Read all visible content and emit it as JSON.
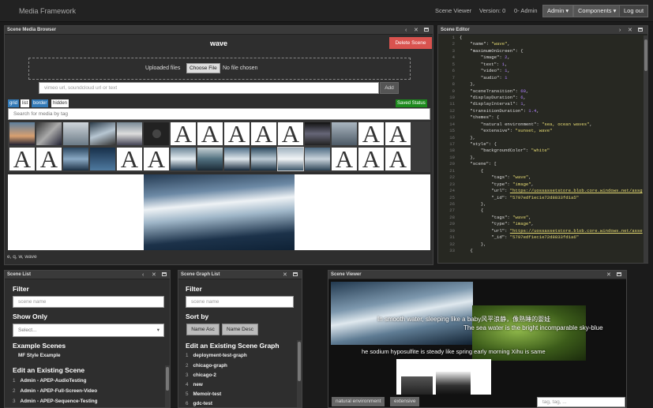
{
  "nav": {
    "title": "Media Framework",
    "scene_viewer": "Scene Viewer",
    "version": "Version: 0",
    "user": "0- Admin",
    "admin": "Admin ▾",
    "components": "Components ▾",
    "logout": "Log out"
  },
  "media_browser": {
    "title": "Scene Media Browser",
    "scene_name": "wave",
    "delete": "Delete Scene",
    "uploaded_label": "Uploaded files",
    "choose_file": "Choose File",
    "no_file": "No file chosen",
    "url_placeholder": "vimeo url, soundcloud url or text",
    "add": "Add",
    "views": [
      "grid",
      "list",
      "border",
      "hidden"
    ],
    "saved": "Saved Status",
    "tag_placeholder": "Search for media by tag",
    "tags_text": "e, q, w, wave"
  },
  "scene_editor": {
    "title": "Scene Editor",
    "lines": [
      [
        {
          "c": "k",
          "t": "{"
        }
      ],
      [
        {
          "c": "k",
          "t": "    \"name\": "
        },
        {
          "c": "s",
          "t": "\"wave\""
        },
        {
          "c": "k",
          "t": ","
        }
      ],
      [
        {
          "c": "k",
          "t": "    \"maximumOnScreen\": {"
        }
      ],
      [
        {
          "c": "k",
          "t": "        \"image\": "
        },
        {
          "c": "n",
          "t": "2"
        },
        {
          "c": "k",
          "t": ","
        }
      ],
      [
        {
          "c": "k",
          "t": "        \"text\": "
        },
        {
          "c": "n",
          "t": "1"
        },
        {
          "c": "k",
          "t": ","
        }
      ],
      [
        {
          "c": "k",
          "t": "        \"video\": "
        },
        {
          "c": "n",
          "t": "1"
        },
        {
          "c": "k",
          "t": ","
        }
      ],
      [
        {
          "c": "k",
          "t": "        \"audio\": "
        },
        {
          "c": "n",
          "t": "1"
        }
      ],
      [
        {
          "c": "k",
          "t": "    },"
        }
      ],
      [
        {
          "c": "k",
          "t": "    \"sceneTransition\": "
        },
        {
          "c": "n",
          "t": "60"
        },
        {
          "c": "k",
          "t": ","
        }
      ],
      [
        {
          "c": "k",
          "t": "    \"displayDuration\": "
        },
        {
          "c": "n",
          "t": "6"
        },
        {
          "c": "k",
          "t": ","
        }
      ],
      [
        {
          "c": "k",
          "t": "    \"displayInterval\": "
        },
        {
          "c": "n",
          "t": "1"
        },
        {
          "c": "k",
          "t": ","
        }
      ],
      [
        {
          "c": "k",
          "t": "    \"transitionDuration\": "
        },
        {
          "c": "n",
          "t": "1.4"
        },
        {
          "c": "k",
          "t": ","
        }
      ],
      [
        {
          "c": "k",
          "t": "    \"themes\": {"
        }
      ],
      [
        {
          "c": "k",
          "t": "        \"natural environment\": "
        },
        {
          "c": "s",
          "t": "\"sea, ocean waves\""
        },
        {
          "c": "k",
          "t": ","
        }
      ],
      [
        {
          "c": "k",
          "t": "        \"extensive\": "
        },
        {
          "c": "s",
          "t": "\"sunset, wave\""
        }
      ],
      [
        {
          "c": "k",
          "t": "    },"
        }
      ],
      [
        {
          "c": "k",
          "t": "    \"style\": {"
        }
      ],
      [
        {
          "c": "k",
          "t": "        \"backgroundColor\": "
        },
        {
          "c": "s",
          "t": "\"white\""
        }
      ],
      [
        {
          "c": "k",
          "t": "    },"
        }
      ],
      [
        {
          "c": "k",
          "t": "    \"scene\": ["
        }
      ],
      [
        {
          "c": "k",
          "t": "        {"
        }
      ],
      [
        {
          "c": "k",
          "t": "            \"tags\": "
        },
        {
          "c": "s",
          "t": "\"wave\""
        },
        {
          "c": "k",
          "t": ","
        }
      ],
      [
        {
          "c": "k",
          "t": "            \"type\": "
        },
        {
          "c": "s",
          "t": "\"image\""
        },
        {
          "c": "k",
          "t": ","
        }
      ],
      [
        {
          "c": "k",
          "t": "            \"url\": "
        },
        {
          "c": "u",
          "t": "\"https://uossassetstore.blob.core.windows.net/assg"
        }
      ],
      [
        {
          "c": "k",
          "t": "            \"_id\": "
        },
        {
          "c": "s",
          "t": "\"5797edf1ec1e72d8833fd1a5\""
        }
      ],
      [
        {
          "c": "k",
          "t": "        },"
        }
      ],
      [
        {
          "c": "k",
          "t": "        {"
        }
      ],
      [
        {
          "c": "k",
          "t": "            \"tags\": "
        },
        {
          "c": "s",
          "t": "\"wave\""
        },
        {
          "c": "k",
          "t": ","
        }
      ],
      [
        {
          "c": "k",
          "t": "            \"type\": "
        },
        {
          "c": "s",
          "t": "\"image\""
        },
        {
          "c": "k",
          "t": ","
        }
      ],
      [
        {
          "c": "k",
          "t": "            \"url\": "
        },
        {
          "c": "u",
          "t": "\"https://uossassetstore.blob.core.windows.net/asse"
        }
      ],
      [
        {
          "c": "k",
          "t": "            \"_id\": "
        },
        {
          "c": "s",
          "t": "\"5797edf1ec1e72d8833fd1a6\""
        }
      ],
      [
        {
          "c": "k",
          "t": "        },"
        }
      ],
      [
        {
          "c": "k",
          "t": "    {"
        }
      ]
    ]
  },
  "scene_list": {
    "title": "Scene List",
    "filter": "Filter",
    "name_placeholder": "scene name",
    "show_only": "Show Only",
    "select": "Select...",
    "examples": "Example Scenes",
    "example_item": "MF Style Example",
    "edit": "Edit an Existing Scene",
    "items": [
      {
        "n": "1",
        "t": "Admin - APEP-AudioTesting"
      },
      {
        "n": "2",
        "t": "Admin - APEP-Full-Screen-Video"
      },
      {
        "n": "3",
        "t": "Admin - APEP-Sequence-Testing"
      }
    ]
  },
  "graph_list": {
    "title": "Scene Graph List",
    "filter": "Filter",
    "name_placeholder": "scene name",
    "sort_by": "Sort by",
    "asc": "Name Asc",
    "desc": "Name Desc",
    "edit": "Edit an Existing Scene Graph",
    "items": [
      {
        "n": "1",
        "t": "deployment-test-graph"
      },
      {
        "n": "2",
        "t": "chicago-graph"
      },
      {
        "n": "3",
        "t": "chicago-2"
      },
      {
        "n": "4",
        "t": "new"
      },
      {
        "n": "5",
        "t": "Memoir-test"
      },
      {
        "n": "6",
        "t": "gdc-test"
      }
    ]
  },
  "viewer": {
    "title": "Scene Viewer",
    "line1": "In smooth water, sleeping like a baby风平浪静，像熟睡的婴娃",
    "line2": "The sea water is the bright incomparable sky-blue",
    "line3": "he sodium hyposulfite is steady like spring early morning Xihu is same",
    "tags": [
      "natural environment",
      "extensive"
    ],
    "tag_placeholder": "tag, tag, ..."
  }
}
